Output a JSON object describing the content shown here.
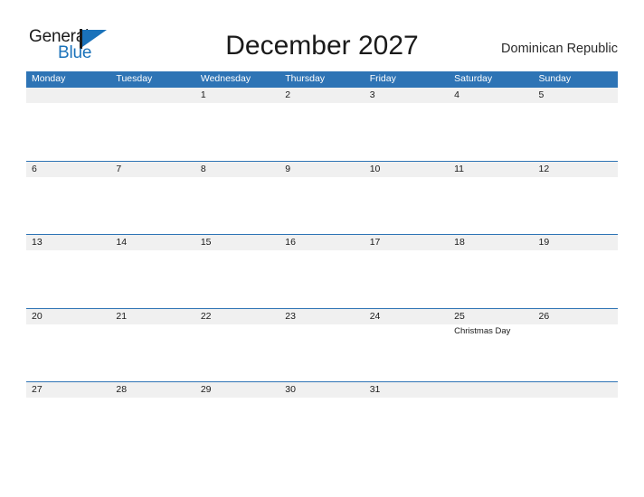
{
  "brand": {
    "name_part1": "General",
    "name_part2": "Blue",
    "flag_icon": "flag-triangle-icon"
  },
  "header": {
    "title": "December 2027",
    "country": "Dominican Republic"
  },
  "colors": {
    "header_blue": "#2e74b5",
    "band_gray": "#f0f0f0",
    "logo_blue": "#1a72ba",
    "text_dark": "#1a1a1a"
  },
  "calendar": {
    "weekdays": [
      "Monday",
      "Tuesday",
      "Wednesday",
      "Thursday",
      "Friday",
      "Saturday",
      "Sunday"
    ],
    "weeks": [
      [
        {
          "num": "",
          "event": ""
        },
        {
          "num": "",
          "event": ""
        },
        {
          "num": "1",
          "event": ""
        },
        {
          "num": "2",
          "event": ""
        },
        {
          "num": "3",
          "event": ""
        },
        {
          "num": "4",
          "event": ""
        },
        {
          "num": "5",
          "event": ""
        }
      ],
      [
        {
          "num": "6",
          "event": ""
        },
        {
          "num": "7",
          "event": ""
        },
        {
          "num": "8",
          "event": ""
        },
        {
          "num": "9",
          "event": ""
        },
        {
          "num": "10",
          "event": ""
        },
        {
          "num": "11",
          "event": ""
        },
        {
          "num": "12",
          "event": ""
        }
      ],
      [
        {
          "num": "13",
          "event": ""
        },
        {
          "num": "14",
          "event": ""
        },
        {
          "num": "15",
          "event": ""
        },
        {
          "num": "16",
          "event": ""
        },
        {
          "num": "17",
          "event": ""
        },
        {
          "num": "18",
          "event": ""
        },
        {
          "num": "19",
          "event": ""
        }
      ],
      [
        {
          "num": "20",
          "event": ""
        },
        {
          "num": "21",
          "event": ""
        },
        {
          "num": "22",
          "event": ""
        },
        {
          "num": "23",
          "event": ""
        },
        {
          "num": "24",
          "event": ""
        },
        {
          "num": "25",
          "event": "Christmas Day"
        },
        {
          "num": "26",
          "event": ""
        }
      ],
      [
        {
          "num": "27",
          "event": ""
        },
        {
          "num": "28",
          "event": ""
        },
        {
          "num": "29",
          "event": ""
        },
        {
          "num": "30",
          "event": ""
        },
        {
          "num": "31",
          "event": ""
        },
        {
          "num": "",
          "event": ""
        },
        {
          "num": "",
          "event": ""
        }
      ]
    ]
  }
}
